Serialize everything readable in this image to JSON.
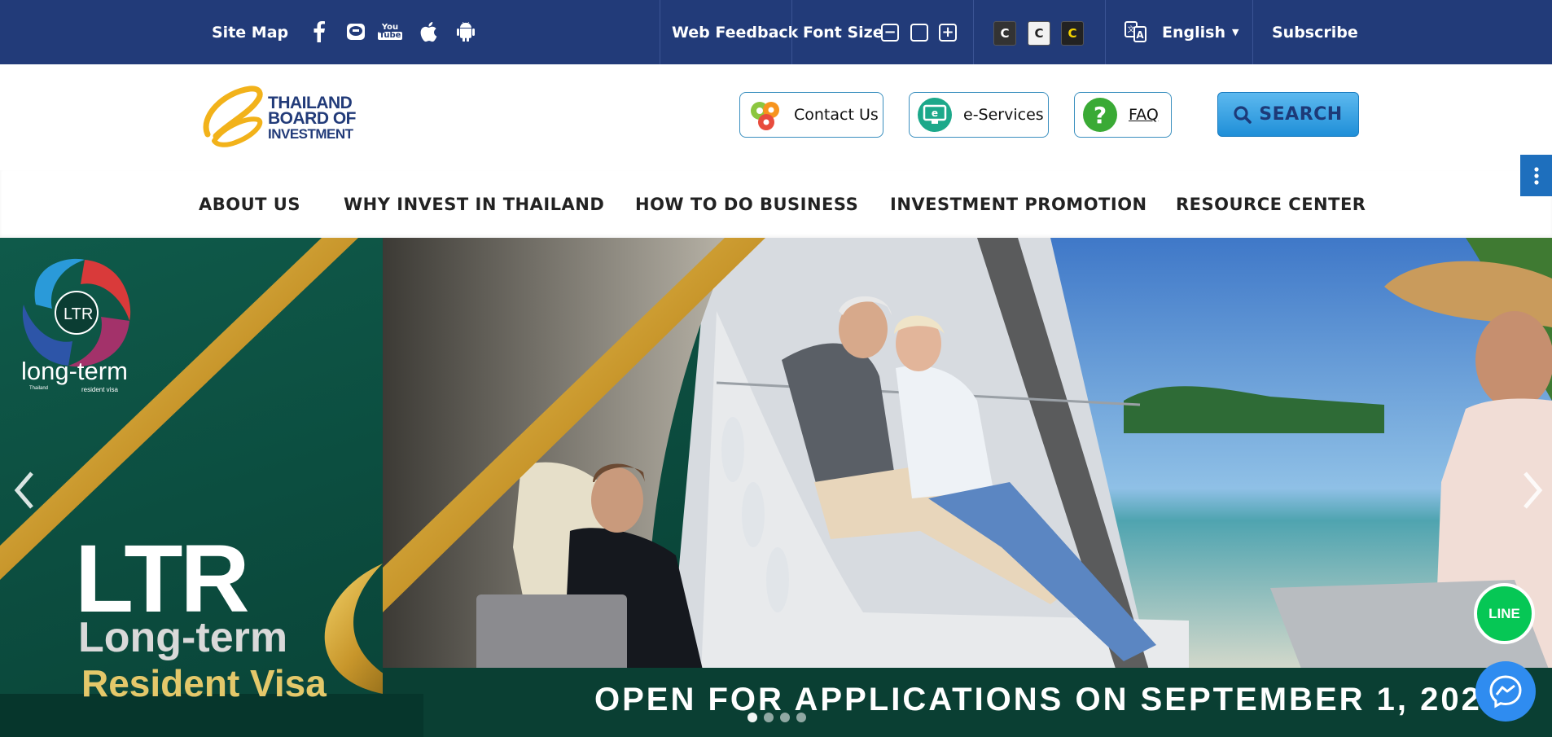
{
  "topbar": {
    "site_map": "Site Map",
    "social_icons": [
      "facebook-icon",
      "line-icon",
      "youtube-icon",
      "apple-icon",
      "android-icon"
    ],
    "youtube_top": "You",
    "youtube_bottom": "Tube",
    "web_feedback": "Web Feedback",
    "font_size": "Font Size",
    "font_buttons": [
      "−",
      "",
      "+"
    ],
    "contrast_buttons": [
      "C",
      "C",
      "C"
    ],
    "language": "English",
    "subscribe": "Subscribe"
  },
  "header": {
    "logo_lines": [
      "THAILAND",
      "BOARD OF",
      "INVESTMENT"
    ],
    "contact_us": "Contact Us",
    "e_services": "e-Services",
    "eservices_icon_text": "e",
    "faq": "FAQ",
    "faq_icon_text": "?",
    "search": "SEARCH"
  },
  "nav": {
    "items": [
      "ABOUT US",
      "WHY INVEST IN THAILAND",
      "HOW TO DO BUSINESS",
      "INVESTMENT PROMOTION",
      "RESOURCE CENTER"
    ]
  },
  "hero": {
    "logo_badge": "LTR",
    "logo_word": "long-term",
    "logo_left_sub": "Thailand",
    "logo_sub": "resident visa",
    "title_ltr": "LTR",
    "title_line2": "Long-term",
    "title_line3": "Resident Visa",
    "banner": "OPEN FOR APPLICATIONS ON SEPTEMBER 1, 2022",
    "slides": 4,
    "active_slide": 1
  },
  "floating": {
    "line_label": "LINE"
  },
  "colors": {
    "topbar_bg": "#223b79",
    "accent_blue": "#1f8fd8",
    "hero_green": "#0c4a3d",
    "gold": "#d4b04a",
    "line_green": "#06c755",
    "messenger_blue": "#2f8cf0"
  }
}
